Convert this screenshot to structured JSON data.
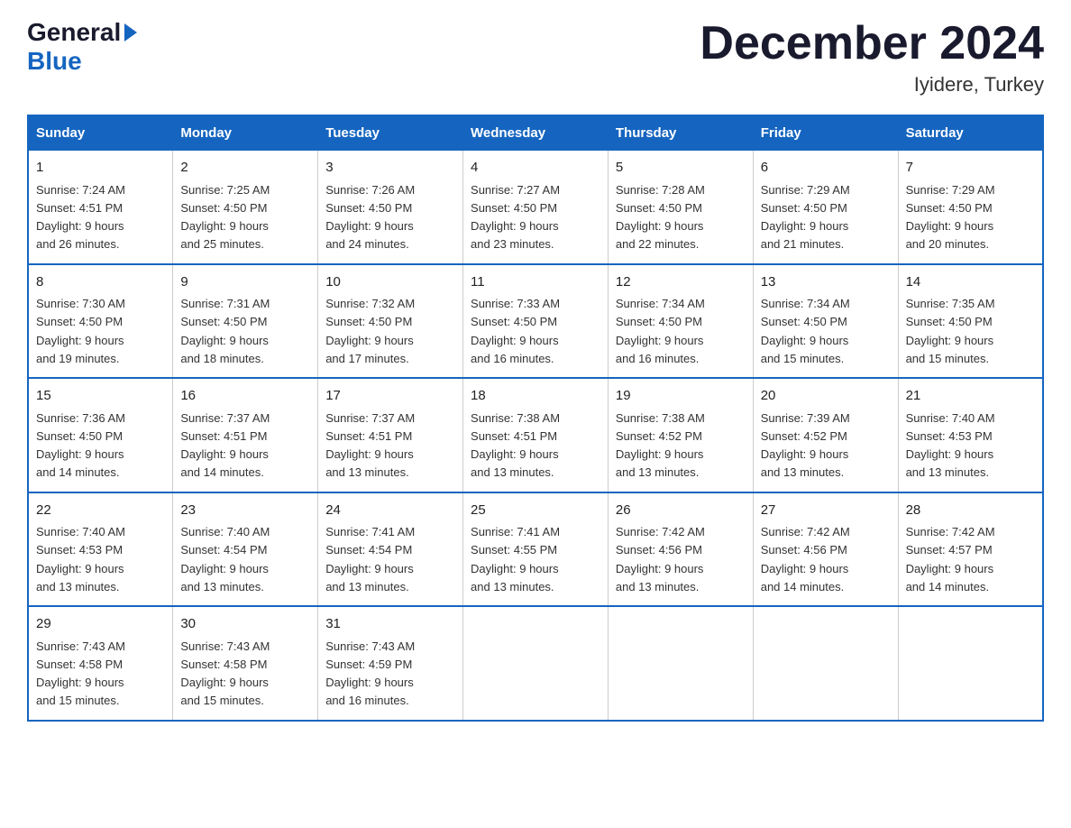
{
  "logo": {
    "general": "General",
    "blue": "Blue"
  },
  "title": "December 2024",
  "subtitle": "Iyidere, Turkey",
  "days_header": [
    "Sunday",
    "Monday",
    "Tuesday",
    "Wednesday",
    "Thursday",
    "Friday",
    "Saturday"
  ],
  "weeks": [
    [
      {
        "day": "1",
        "sunrise": "7:24 AM",
        "sunset": "4:51 PM",
        "daylight": "9 hours and 26 minutes."
      },
      {
        "day": "2",
        "sunrise": "7:25 AM",
        "sunset": "4:50 PM",
        "daylight": "9 hours and 25 minutes."
      },
      {
        "day": "3",
        "sunrise": "7:26 AM",
        "sunset": "4:50 PM",
        "daylight": "9 hours and 24 minutes."
      },
      {
        "day": "4",
        "sunrise": "7:27 AM",
        "sunset": "4:50 PM",
        "daylight": "9 hours and 23 minutes."
      },
      {
        "day": "5",
        "sunrise": "7:28 AM",
        "sunset": "4:50 PM",
        "daylight": "9 hours and 22 minutes."
      },
      {
        "day": "6",
        "sunrise": "7:29 AM",
        "sunset": "4:50 PM",
        "daylight": "9 hours and 21 minutes."
      },
      {
        "day": "7",
        "sunrise": "7:29 AM",
        "sunset": "4:50 PM",
        "daylight": "9 hours and 20 minutes."
      }
    ],
    [
      {
        "day": "8",
        "sunrise": "7:30 AM",
        "sunset": "4:50 PM",
        "daylight": "9 hours and 19 minutes."
      },
      {
        "day": "9",
        "sunrise": "7:31 AM",
        "sunset": "4:50 PM",
        "daylight": "9 hours and 18 minutes."
      },
      {
        "day": "10",
        "sunrise": "7:32 AM",
        "sunset": "4:50 PM",
        "daylight": "9 hours and 17 minutes."
      },
      {
        "day": "11",
        "sunrise": "7:33 AM",
        "sunset": "4:50 PM",
        "daylight": "9 hours and 16 minutes."
      },
      {
        "day": "12",
        "sunrise": "7:34 AM",
        "sunset": "4:50 PM",
        "daylight": "9 hours and 16 minutes."
      },
      {
        "day": "13",
        "sunrise": "7:34 AM",
        "sunset": "4:50 PM",
        "daylight": "9 hours and 15 minutes."
      },
      {
        "day": "14",
        "sunrise": "7:35 AM",
        "sunset": "4:50 PM",
        "daylight": "9 hours and 15 minutes."
      }
    ],
    [
      {
        "day": "15",
        "sunrise": "7:36 AM",
        "sunset": "4:50 PM",
        "daylight": "9 hours and 14 minutes."
      },
      {
        "day": "16",
        "sunrise": "7:37 AM",
        "sunset": "4:51 PM",
        "daylight": "9 hours and 14 minutes."
      },
      {
        "day": "17",
        "sunrise": "7:37 AM",
        "sunset": "4:51 PM",
        "daylight": "9 hours and 13 minutes."
      },
      {
        "day": "18",
        "sunrise": "7:38 AM",
        "sunset": "4:51 PM",
        "daylight": "9 hours and 13 minutes."
      },
      {
        "day": "19",
        "sunrise": "7:38 AM",
        "sunset": "4:52 PM",
        "daylight": "9 hours and 13 minutes."
      },
      {
        "day": "20",
        "sunrise": "7:39 AM",
        "sunset": "4:52 PM",
        "daylight": "9 hours and 13 minutes."
      },
      {
        "day": "21",
        "sunrise": "7:40 AM",
        "sunset": "4:53 PM",
        "daylight": "9 hours and 13 minutes."
      }
    ],
    [
      {
        "day": "22",
        "sunrise": "7:40 AM",
        "sunset": "4:53 PM",
        "daylight": "9 hours and 13 minutes."
      },
      {
        "day": "23",
        "sunrise": "7:40 AM",
        "sunset": "4:54 PM",
        "daylight": "9 hours and 13 minutes."
      },
      {
        "day": "24",
        "sunrise": "7:41 AM",
        "sunset": "4:54 PM",
        "daylight": "9 hours and 13 minutes."
      },
      {
        "day": "25",
        "sunrise": "7:41 AM",
        "sunset": "4:55 PM",
        "daylight": "9 hours and 13 minutes."
      },
      {
        "day": "26",
        "sunrise": "7:42 AM",
        "sunset": "4:56 PM",
        "daylight": "9 hours and 13 minutes."
      },
      {
        "day": "27",
        "sunrise": "7:42 AM",
        "sunset": "4:56 PM",
        "daylight": "9 hours and 14 minutes."
      },
      {
        "day": "28",
        "sunrise": "7:42 AM",
        "sunset": "4:57 PM",
        "daylight": "9 hours and 14 minutes."
      }
    ],
    [
      {
        "day": "29",
        "sunrise": "7:43 AM",
        "sunset": "4:58 PM",
        "daylight": "9 hours and 15 minutes."
      },
      {
        "day": "30",
        "sunrise": "7:43 AM",
        "sunset": "4:58 PM",
        "daylight": "9 hours and 15 minutes."
      },
      {
        "day": "31",
        "sunrise": "7:43 AM",
        "sunset": "4:59 PM",
        "daylight": "9 hours and 16 minutes."
      },
      null,
      null,
      null,
      null
    ]
  ],
  "labels": {
    "sunrise": "Sunrise:",
    "sunset": "Sunset:",
    "daylight": "Daylight:"
  }
}
